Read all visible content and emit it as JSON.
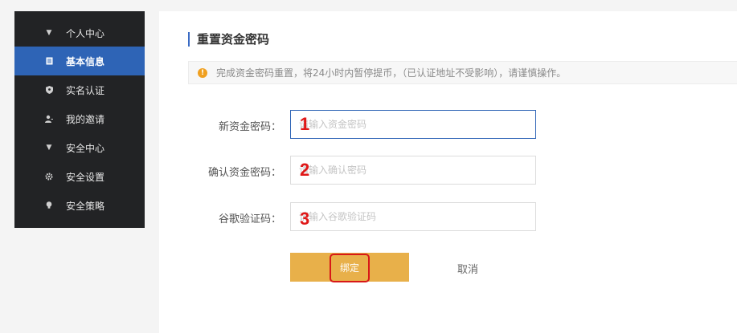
{
  "sidebar": {
    "items": [
      {
        "label": "个人中心",
        "icon": "caret-down-icon",
        "type": "section"
      },
      {
        "label": "基本信息",
        "icon": "document-icon",
        "type": "item",
        "active": true
      },
      {
        "label": "实名认证",
        "icon": "shield-icon",
        "type": "item"
      },
      {
        "label": "我的邀请",
        "icon": "user-add-icon",
        "type": "item"
      },
      {
        "label": "安全中心",
        "icon": "caret-down-icon",
        "type": "section"
      },
      {
        "label": "安全设置",
        "icon": "gear-icon",
        "type": "item"
      },
      {
        "label": "安全策略",
        "icon": "lightbulb-icon",
        "type": "item"
      }
    ]
  },
  "main": {
    "title": "重置资金密码",
    "notice": "完成资金密码重置，将24小时内暂停提币，（已认证地址不受影响），请谨慎操作。"
  },
  "form": {
    "new_password": {
      "label": "新资金密码：",
      "placeholder": "请输入资金密码",
      "annotation": "1"
    },
    "confirm_password": {
      "label": "确认资金密码：",
      "placeholder": "请输入确认密码",
      "annotation": "2"
    },
    "google_code": {
      "label": "谷歌验证码：",
      "placeholder": "请输入谷歌验证码",
      "annotation": "3"
    },
    "submit_label": "绑定",
    "cancel_label": "取消"
  },
  "colors": {
    "sidebar_bg": "#222325",
    "active_bg": "#2e64b6",
    "submit_bg": "#e8b04a",
    "annotation": "#e01818",
    "warning": "#f0a020"
  }
}
